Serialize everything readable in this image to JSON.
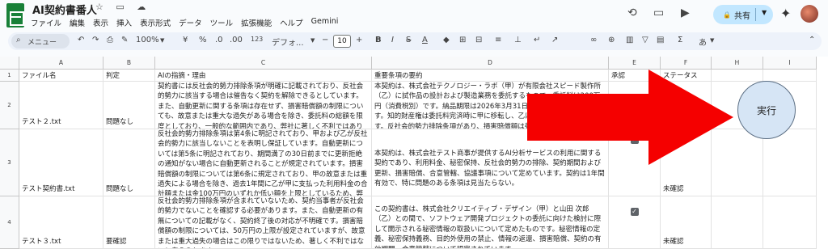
{
  "header": {
    "title": "AI契約書番人",
    "title_icons": "☆ ▭ ☁",
    "menus": [
      "ファイル",
      "編集",
      "表示",
      "挿入",
      "表示形式",
      "データ",
      "ツール",
      "拡張機能",
      "ヘルプ",
      "Gemini"
    ],
    "share_label": "共有",
    "lock_icon": "🔒"
  },
  "toolbar": {
    "search_label": "メニュー",
    "zoom": "100%",
    "currency": "¥",
    "percent": "%",
    "decimal_less": ".0",
    "decimal_more": ".00",
    "number_format": "123",
    "font": "デフォ...",
    "font_size": "10",
    "input_tools": "あ"
  },
  "sheet": {
    "column_letters": [
      "A",
      "B",
      "C",
      "D",
      "E",
      "F",
      "H",
      "I"
    ],
    "row_numbers": [
      "1",
      "2",
      "3",
      "4"
    ],
    "headers": [
      "ファイル名",
      "判定",
      "AIの指摘・理由",
      "重要条項の要約",
      "承認",
      "ステータス"
    ],
    "rows": [
      {
        "file": "テスト２.txt",
        "verdict": "問題なし",
        "ai_reason": "契約書には反社会的勢力排除条項が明確に記載されており、反社会的勢力に該当する場合は催告なく契約を解除できるとしています。また、自動更新に関する条項は存在せず、損害賠償額の制限についても、故意または重大な過失がある場合を除き、委託料の総額を限度としており、一般的な範囲内であり、弊社に著しく不利ではありません。",
        "summary": "本契約は、株式会社テクノロジー・ラボ（甲）が有限会社スピード製作所（乙）に試作品の設計および製造業務を委託するもので、委託料は200万円（消費税別）です。納品期限は2026年3月31日で、検収期間は10日間です。知的財産権は委託料完済時に甲に移転し、乙は秘密保持義務を負います。反社会的勢力排除条項があり、損害賠償額は委託料総額を上限としています。紛争は大阪地方裁判所が管轄します。",
        "approved": false,
        "status": ""
      },
      {
        "file": "テスト契約書.txt",
        "verdict": "問題なし",
        "ai_reason": "反社会的勢力排除条項は第4条に明記されており、甲および乙が反社会的勢力に該当しないことを表明し保証しています。自動更新については第5条に明記されており、期間満了の30日前までに更新拒絶の通知がない場合に自動更新されることが規定されています。損害賠償額の制限については第6条に規定されており、甲の故意または重過失による場合を除き、過去1年間に乙が甲に支払った利用料金の合計額または金100万円のいずれか低い額を上限としているため、弊社に著しく不利ではない。",
        "summary": "本契約は、株式会社テスト商事が提供するAI分析サービスの利用に関する契約であり、利用料金、秘密保持、反社会的勢力の排除、契約期間および更新、損害賠償、合意管轄、協議事項について定めています。契約は1年間有効で、特に問題のある条項は見当たらない。",
        "approved": true,
        "status": "未確認"
      },
      {
        "file": "テスト３.txt",
        "verdict": "要確認",
        "ai_reason": "反社会的勢力排除条項が含まれていないため、契約当事者が反社会的勢力でないことを確認する必要があります。また、自動更新の有無についての記載がなく、契約終了後の対応が不明確です。損害賠償額の制限については、50万円の上限が設定されていますが、故意または重大過失の場合はこの限りではないため、著しく不利ではないと考えられます。",
        "summary": "この契約書は、株式会社クリエイティブ・デザイン（甲）と山田 次郎（乙）との間で、ソフトウェア開発プロジェクトの委託に向けた検討に際して開示される秘密情報の取扱いについて定めたものです。秘密情報の定義、秘密保持義務、目的外使用の禁止、情報の返還、損害賠償、契約の有効期間、合意管轄について規定されています。",
        "approved": true,
        "status": "未確認"
      }
    ]
  },
  "run_button_label": "実行",
  "colors": {
    "arrow": "#f50000",
    "run_button_bg": "#d6e5f5",
    "share_bg": "#c2e7ff",
    "sheets_green": "#188038"
  },
  "icons": [
    "history-icon",
    "comment-icon",
    "video-icon",
    "lock-icon",
    "sparkle-icon",
    "avatar"
  ]
}
